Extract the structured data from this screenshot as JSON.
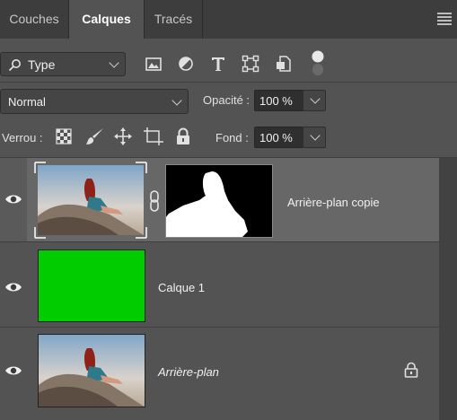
{
  "tabs": [
    {
      "label": "Couches",
      "active": false
    },
    {
      "label": "Calques",
      "active": true
    },
    {
      "label": "Tracés",
      "active": false
    }
  ],
  "filter": {
    "type_label": "Type",
    "icons": [
      "image-filter-icon",
      "adjustment-filter-icon",
      "text-filter-icon",
      "shape-filter-icon",
      "smart-object-filter-icon",
      "filter-toggle-icon"
    ]
  },
  "blend": {
    "mode": "Normal",
    "opacity_label": "Opacité :",
    "opacity_value": "100 %"
  },
  "lock": {
    "label": "Verrou :",
    "fill_label": "Fond :",
    "fill_value": "100 %",
    "icons": [
      "lock-transparent-pixels-icon",
      "lock-image-pixels-icon",
      "lock-position-icon",
      "lock-artboard-icon",
      "lock-all-icon"
    ]
  },
  "layers": [
    {
      "name": "Arrière-plan copie",
      "selected": true,
      "visible": true,
      "thumb": "photo",
      "has_mask": true,
      "italic": false,
      "locked": false
    },
    {
      "name": "Calque 1",
      "selected": false,
      "visible": true,
      "thumb": "green",
      "thumb_color": "#00cc00",
      "has_mask": false,
      "italic": false,
      "locked": false
    },
    {
      "name": "Arrière-plan",
      "selected": false,
      "visible": true,
      "thumb": "photo",
      "has_mask": false,
      "italic": true,
      "locked": true
    }
  ],
  "colors": {
    "panel": "#535353",
    "tabbar": "#3d3d3d",
    "selected_row": "#676767",
    "green_fill": "#00cc00"
  }
}
